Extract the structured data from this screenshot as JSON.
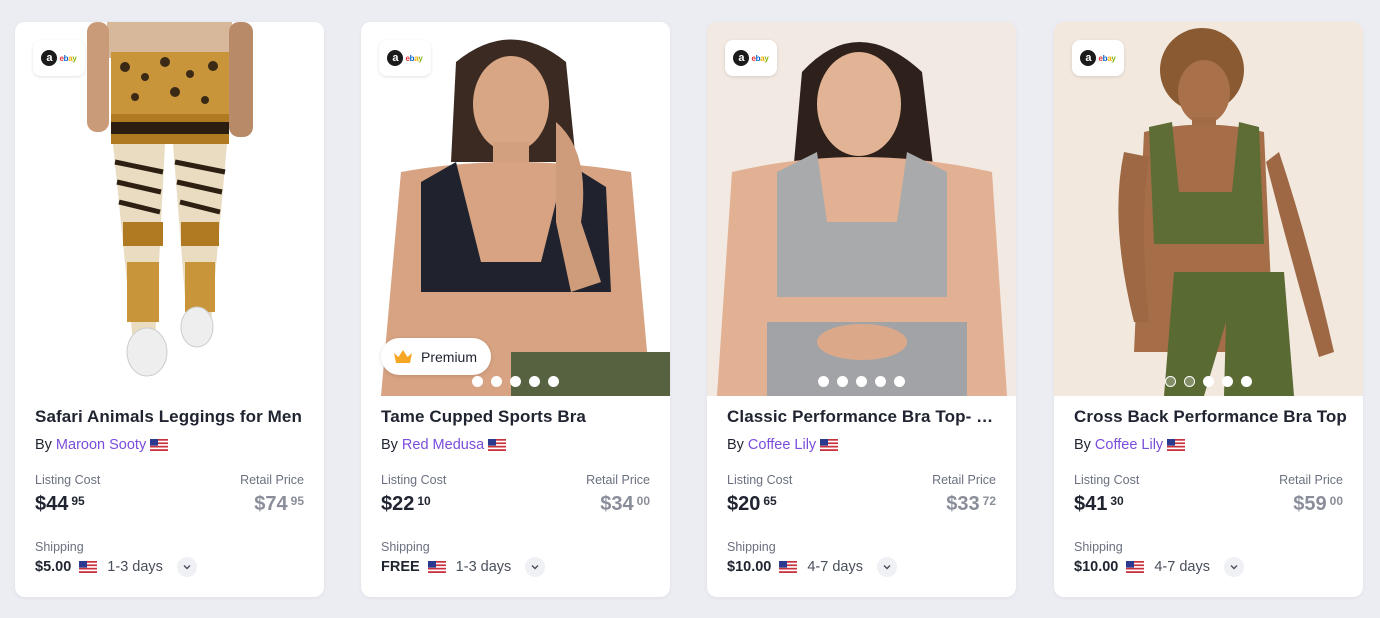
{
  "flag_colors": {
    "red": "#c8313e",
    "white": "#ffffff",
    "blue": "#2b3a8f"
  },
  "accent": "#7a4ddb",
  "icons": {
    "store": "ebay-store-icon",
    "premium": "crown-icon",
    "expand": "chevron-down-icon",
    "flag": "us-flag-icon"
  },
  "products": [
    {
      "title": "Safari Animals Leggings for Men",
      "by": "By",
      "brand": "Maroon Sooty",
      "listing_label": "Listing Cost",
      "retail_label": "Retail Price",
      "listing_dollars": "$44",
      "listing_cents": "95",
      "retail_dollars": "$74",
      "retail_cents": "95",
      "shipping_label": "Shipping",
      "shipping_price": "$5.00",
      "shipping_days": "1-3 days",
      "slides": 5,
      "active_slide": 2
    },
    {
      "title": "Tame Cupped Sports Bra",
      "by": "By",
      "brand": "Red Medusa",
      "premium": "Premium",
      "listing_label": "Listing Cost",
      "retail_label": "Retail Price",
      "listing_dollars": "$22",
      "listing_cents": "10",
      "retail_dollars": "$34",
      "retail_cents": "00",
      "shipping_label": "Shipping",
      "shipping_price": "FREE",
      "shipping_days": "1-3 days",
      "slides": 5,
      "active_slide": 1
    },
    {
      "title": "Classic Performance Bra Top- Sage",
      "by": "By",
      "brand": "Coffee Lily",
      "listing_label": "Listing Cost",
      "retail_label": "Retail Price",
      "listing_dollars": "$20",
      "listing_cents": "65",
      "retail_dollars": "$33",
      "retail_cents": "72",
      "shipping_label": "Shipping",
      "shipping_price": "$10.00",
      "shipping_days": "4-7 days",
      "slides": 5,
      "active_slide": 1
    },
    {
      "title": "Cross Back Performance Bra Top",
      "by": "By",
      "brand": "Coffee Lily",
      "listing_label": "Listing Cost",
      "retail_label": "Retail Price",
      "listing_dollars": "$41",
      "listing_cents": "30",
      "retail_dollars": "$59",
      "retail_cents": "00",
      "shipping_label": "Shipping",
      "shipping_price": "$10.00",
      "shipping_days": "4-7 days",
      "slides": 5,
      "active_slide": 1
    }
  ]
}
